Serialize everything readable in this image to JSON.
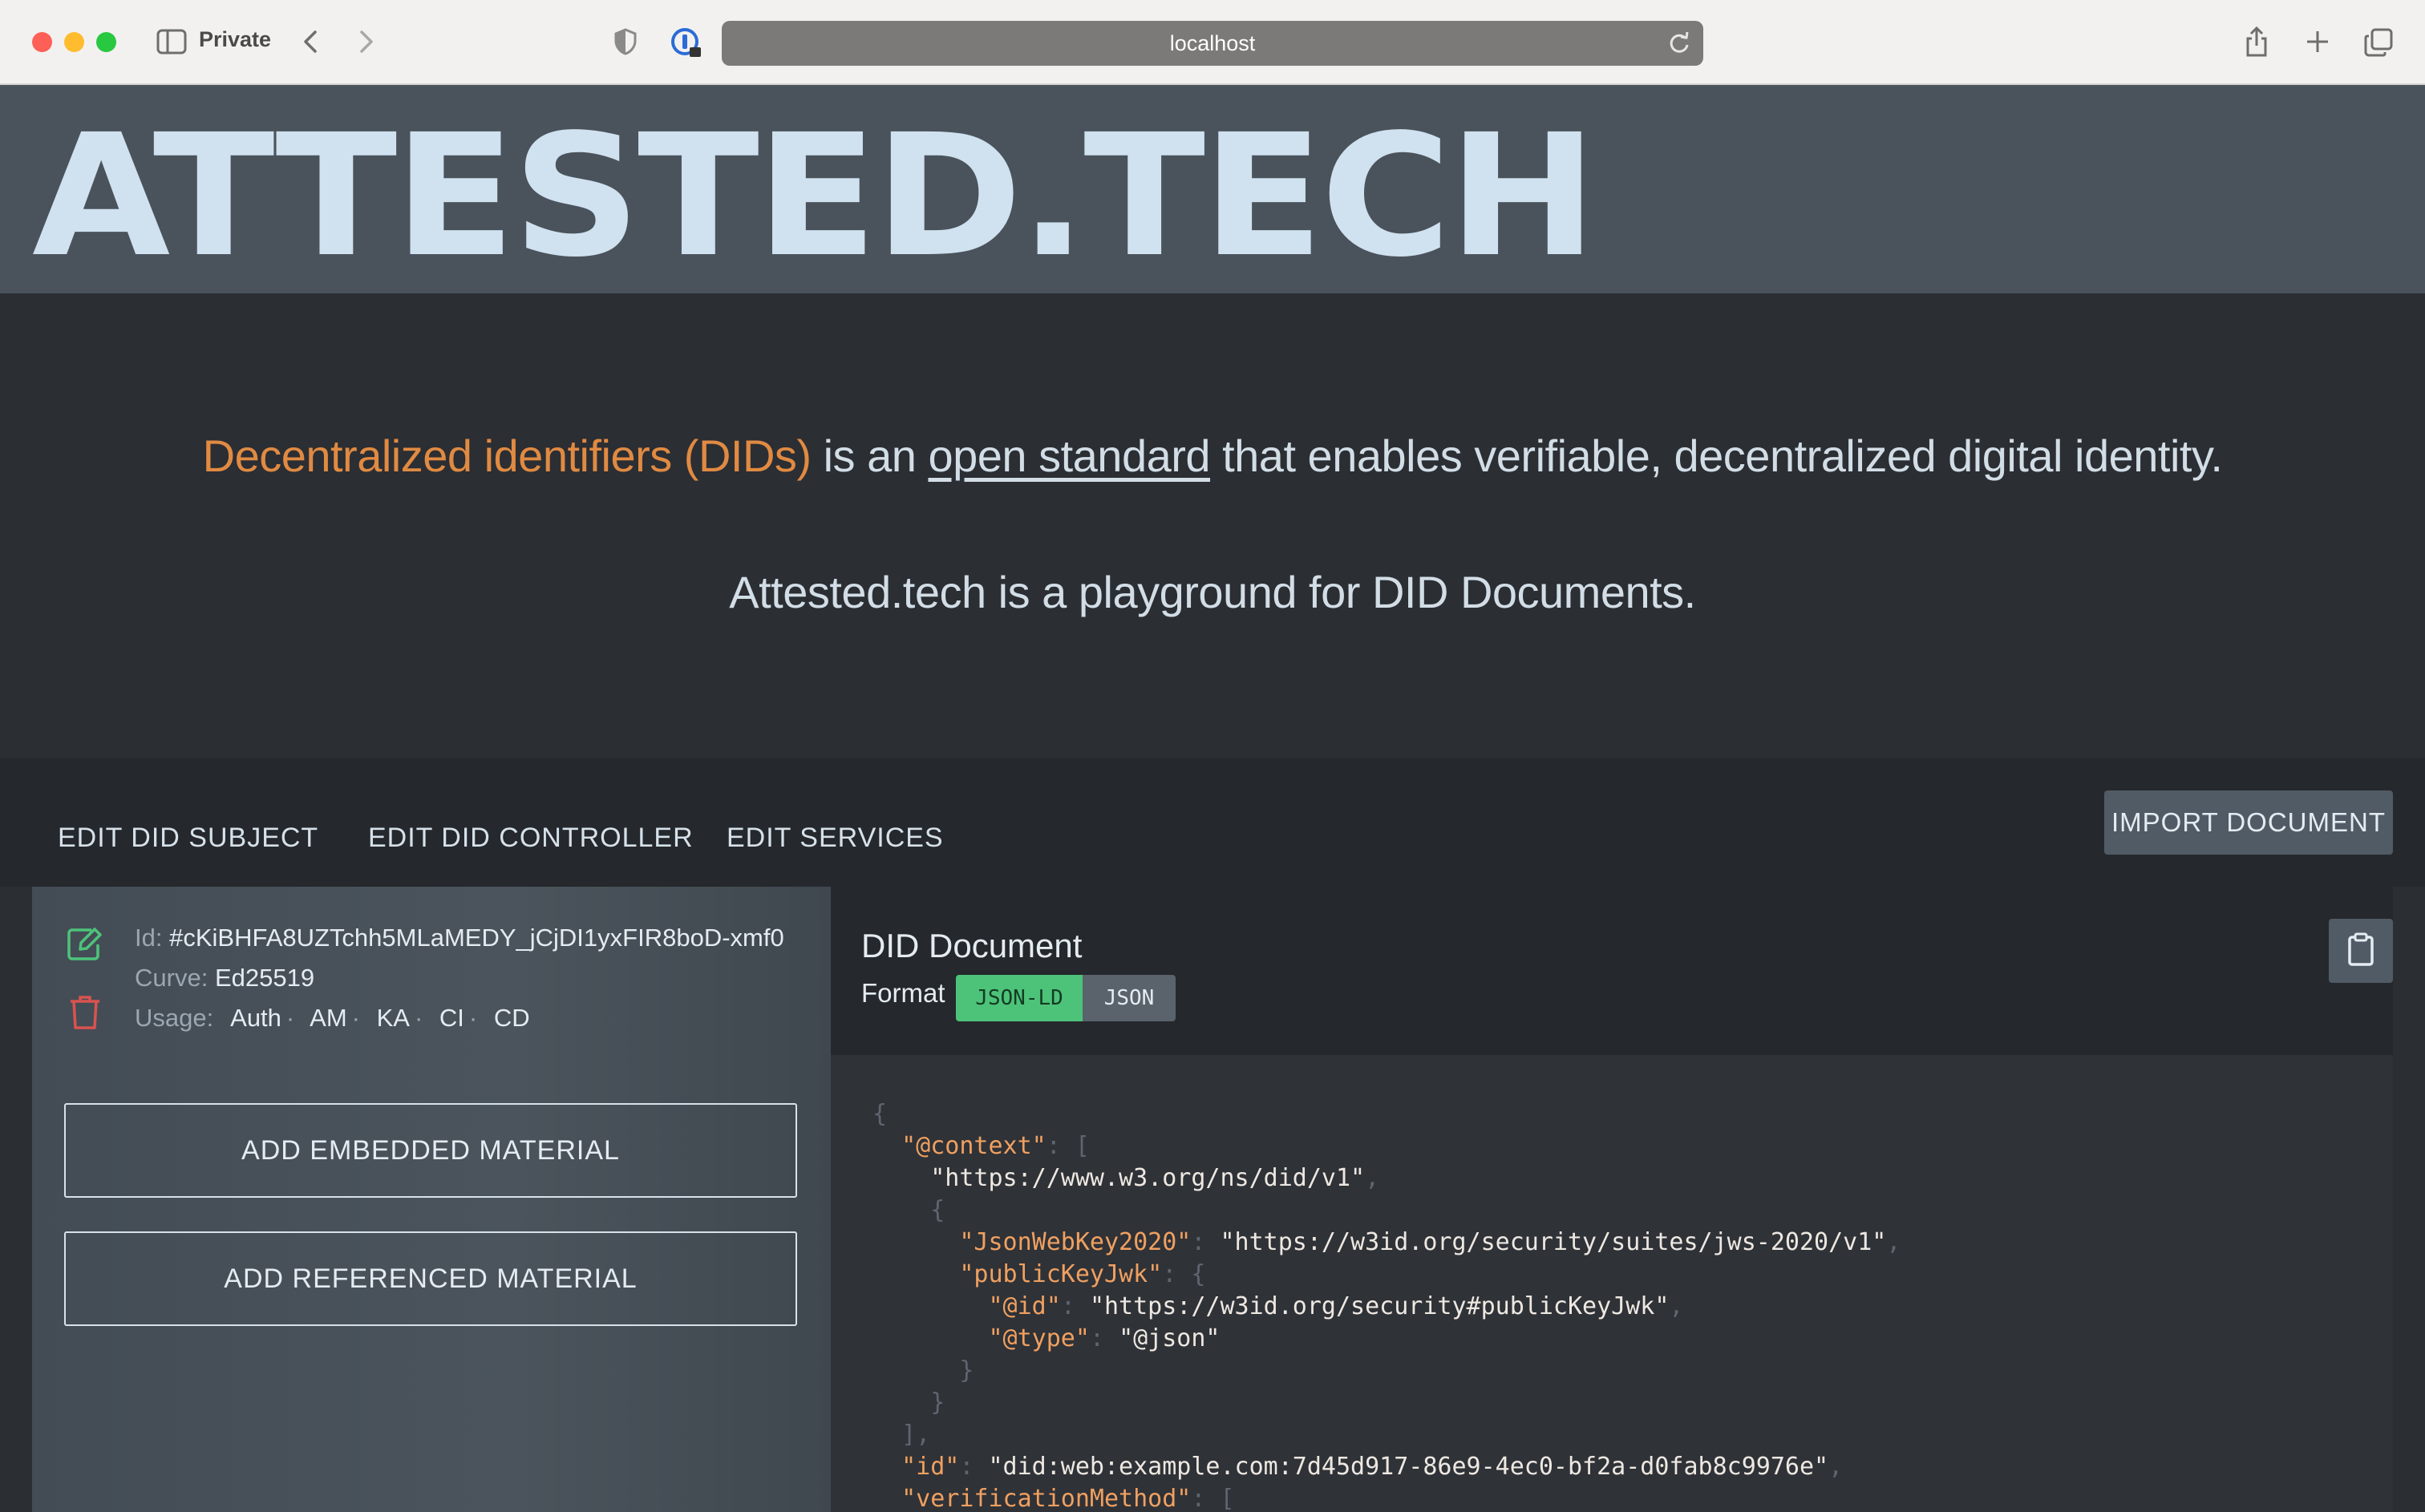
{
  "browser": {
    "mode_label": "Private",
    "url": "localhost"
  },
  "logo": {
    "text": "ATTESTED.TECH"
  },
  "hero": {
    "line1_accent": "Decentralized identifiers (DIDs)",
    "line1_mid": " is an ",
    "line1_link": "open standard",
    "line1_end": " that enables verifiable, decentralized digital identity.",
    "line2": "Attested.tech is a playground for DID Documents."
  },
  "tabs": [
    {
      "label": "EDIT DID SUBJECT"
    },
    {
      "label": "EDIT DID CONTROLLER"
    },
    {
      "label": "EDIT SERVICES"
    }
  ],
  "import_label": "IMPORT DOCUMENT",
  "key": {
    "id_label": "Id:",
    "id_value": "#cKiBHFA8UZTchh5MLaMEDY_jCjDI1yxFIR8boD-xmf0",
    "curve_label": "Curve:",
    "curve_value": "Ed25519",
    "usage_label": "Usage:",
    "usages": [
      "Auth",
      "AM",
      "KA",
      "CI",
      "CD"
    ]
  },
  "buttons": {
    "add_embedded": "ADD EMBEDDED MATERIAL",
    "add_referenced": "ADD REFERENCED MATERIAL"
  },
  "document": {
    "title": "DID Document",
    "format_label": "Format",
    "formats": [
      "JSON-LD",
      "JSON"
    ],
    "active_format": "JSON-LD",
    "code_lines": [
      {
        "indent": 0,
        "parts": [
          {
            "t": "p",
            "v": "{"
          }
        ]
      },
      {
        "indent": 1,
        "parts": [
          {
            "t": "k",
            "v": "\"@context\""
          },
          {
            "t": "p",
            "v": ": ["
          }
        ]
      },
      {
        "indent": 2,
        "parts": [
          {
            "t": "s",
            "v": "\"https://www.w3.org/ns/did/v1\""
          },
          {
            "t": "p",
            "v": ","
          }
        ]
      },
      {
        "indent": 2,
        "parts": [
          {
            "t": "p",
            "v": "{"
          }
        ]
      },
      {
        "indent": 3,
        "parts": [
          {
            "t": "k",
            "v": "\"JsonWebKey2020\""
          },
          {
            "t": "p",
            "v": ": "
          },
          {
            "t": "s",
            "v": "\"https://w3id.org/security/suites/jws-2020/v1\""
          },
          {
            "t": "p",
            "v": ","
          }
        ]
      },
      {
        "indent": 3,
        "parts": [
          {
            "t": "k",
            "v": "\"publicKeyJwk\""
          },
          {
            "t": "p",
            "v": ": {"
          }
        ]
      },
      {
        "indent": 4,
        "parts": [
          {
            "t": "k",
            "v": "\"@id\""
          },
          {
            "t": "p",
            "v": ": "
          },
          {
            "t": "s",
            "v": "\"https://w3id.org/security#publicKeyJwk\""
          },
          {
            "t": "p",
            "v": ","
          }
        ]
      },
      {
        "indent": 4,
        "parts": [
          {
            "t": "k",
            "v": "\"@type\""
          },
          {
            "t": "p",
            "v": ": "
          },
          {
            "t": "s",
            "v": "\"@json\""
          }
        ]
      },
      {
        "indent": 3,
        "parts": [
          {
            "t": "p",
            "v": "}"
          }
        ]
      },
      {
        "indent": 2,
        "parts": [
          {
            "t": "p",
            "v": "}"
          }
        ]
      },
      {
        "indent": 1,
        "parts": [
          {
            "t": "p",
            "v": "],"
          }
        ]
      },
      {
        "indent": 1,
        "parts": [
          {
            "t": "k",
            "v": "\"id\""
          },
          {
            "t": "p",
            "v": ": "
          },
          {
            "t": "s",
            "v": "\"did:web:example.com:7d45d917-86e9-4ec0-bf2a-d0fab8c9976e\""
          },
          {
            "t": "p",
            "v": ","
          }
        ]
      },
      {
        "indent": 1,
        "parts": [
          {
            "t": "k",
            "v": "\"verificationMethod\""
          },
          {
            "t": "p",
            "v": ": ["
          }
        ]
      }
    ]
  }
}
